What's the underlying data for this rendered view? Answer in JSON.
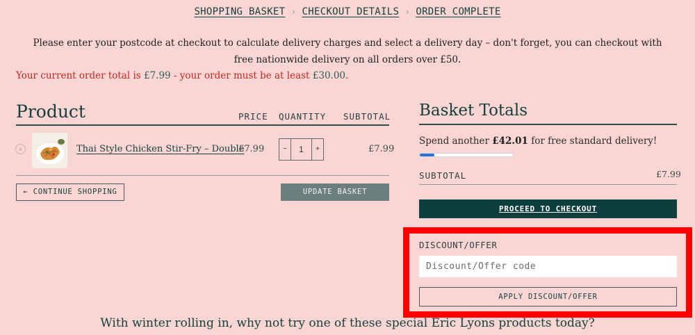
{
  "breadcrumb": [
    "SHOPPING BASKET",
    "CHECKOUT DETAILS",
    "ORDER COMPLETE"
  ],
  "notice": "Please enter your postcode at checkout to calculate delivery charges and select a delivery day – don't forget, you can checkout with free nationwide delivery on all orders over £50.",
  "min_order": {
    "prefix": "Your current order total is ",
    "total": "£7.99",
    "middle": " - your order must be at least ",
    "minimum": "£30.00",
    "suffix": "."
  },
  "cart": {
    "heading": "Product",
    "columns": {
      "price": "PRICE",
      "quantity": "QUANTITY",
      "subtotal": "SUBTOTAL"
    },
    "item": {
      "name": "Thai Style Chicken Stir-Fry – Double",
      "price": "£7.99",
      "quantity": "1",
      "subtotal": "£7.99",
      "remove_icon": "close-icon"
    },
    "qty_minus": "−",
    "qty_plus": "+",
    "continue_label": "← CONTINUE SHOPPING",
    "update_label": "UPDATE BASKET"
  },
  "totals": {
    "heading": "Basket Totals",
    "spend_prefix": "Spend another ",
    "spend_amount": "£42.01",
    "spend_suffix": " for free standard delivery!",
    "progress_percent": 16,
    "progress_color": "#2a6fd6",
    "subtotal_label": "SUBTOTAL",
    "subtotal_value": "£7.99",
    "checkout_label": "PROCEED TO CHECKOUT"
  },
  "discount": {
    "label": "DISCOUNT/OFFER",
    "placeholder": "Discount/Offer code",
    "value": "",
    "apply_label": "APPLY DISCOUNT/OFFER"
  },
  "promo": "With winter rolling in, why not try one of these special Eric Lyons products today?",
  "colors": {
    "background": "#f9d5d4",
    "brand_dark": "#0f3f3c",
    "warning_text": "#c5271d",
    "highlight": "#ff0000"
  }
}
